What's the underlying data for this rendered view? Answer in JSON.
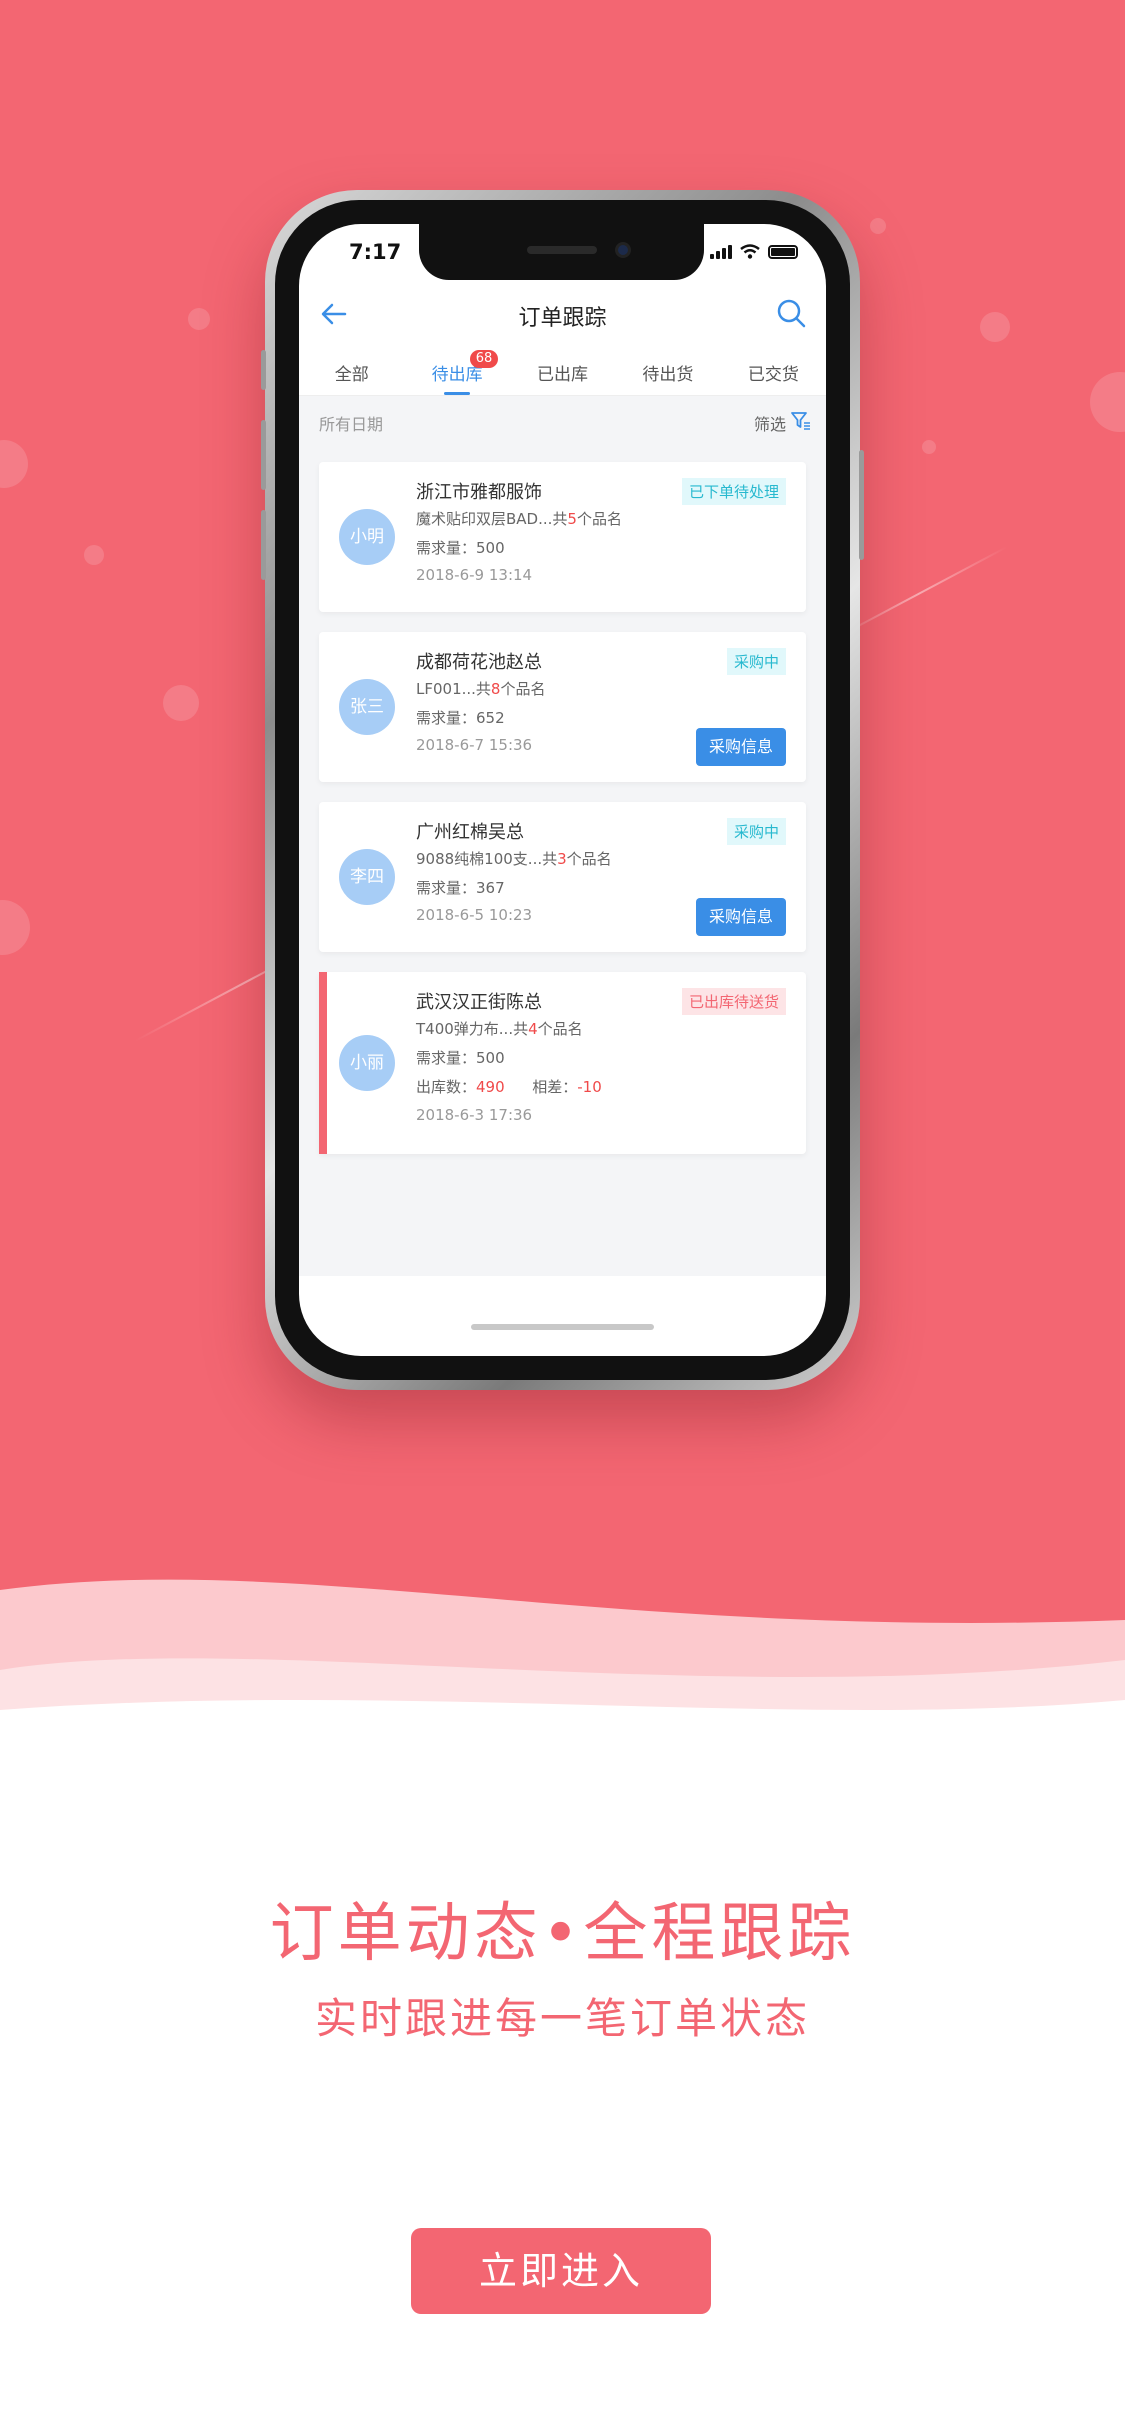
{
  "status": {
    "time": "7:17"
  },
  "nav": {
    "title": "订单跟踪",
    "back_icon": "back-arrow-icon",
    "search_icon": "search-icon"
  },
  "tabs": [
    {
      "label": "全部",
      "active": false
    },
    {
      "label": "待出库",
      "active": true,
      "badge": "68"
    },
    {
      "label": "已出库",
      "active": false
    },
    {
      "label": "待出货",
      "active": false
    },
    {
      "label": "已交货",
      "active": false
    }
  ],
  "filterbar": {
    "date_label": "所有日期",
    "filter_label": "筛选"
  },
  "orders": [
    {
      "avatar": "小明",
      "name": "浙江市雅都服饰",
      "items_prefix": "魔术贴印双层BAD...共",
      "items_count": "5",
      "items_suffix": "个品名",
      "qty": "需求量：500",
      "date": "2018-6-9 13:14",
      "tag": "已下单待处理"
    },
    {
      "avatar": "张三",
      "name": "成都荷花池赵总",
      "items_prefix": "LF001...共",
      "items_count": "8",
      "items_suffix": "个品名",
      "qty": "需求量：652",
      "date": "2018-6-7 15:36",
      "tag": "采购中",
      "button": "采购信息"
    },
    {
      "avatar": "李四",
      "name": "广州红棉吴总",
      "items_prefix": "9088纯棉100支...共",
      "items_count": "3",
      "items_suffix": "个品名",
      "qty": "需求量：367",
      "date": "2018-6-5 10:23",
      "tag": "采购中",
      "button": "采购信息"
    },
    {
      "avatar": "小丽",
      "name": "武汉汉正街陈总",
      "items_prefix": "T400弹力布...共",
      "items_count": "4",
      "items_suffix": "个品名",
      "qty": "需求量：500",
      "out_label": "出库数：",
      "out_value": "490",
      "diff_label": "相差：",
      "diff_value": "-10",
      "date": "2018-6-3 17:36",
      "tag": "已出库待送货"
    }
  ],
  "promo": {
    "headline": "订单动态•全程跟踪",
    "subline": "实时跟进每一笔订单状态",
    "cta": "立即进入"
  },
  "colors": {
    "brand": "#f36672",
    "accent_blue": "#3a8ee6",
    "tag_cyan": "#27b9cf",
    "alert_red": "#f04a4a"
  }
}
